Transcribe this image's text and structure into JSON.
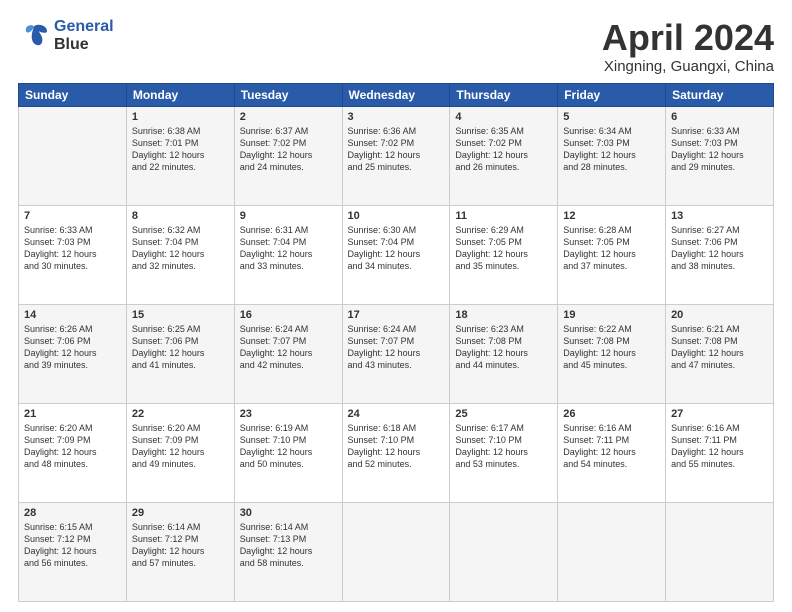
{
  "header": {
    "logo_line1": "General",
    "logo_line2": "Blue",
    "title": "April 2024",
    "location": "Xingning, Guangxi, China"
  },
  "columns": [
    "Sunday",
    "Monday",
    "Tuesday",
    "Wednesday",
    "Thursday",
    "Friday",
    "Saturday"
  ],
  "weeks": [
    [
      {
        "day": "",
        "info": ""
      },
      {
        "day": "1",
        "info": "Sunrise: 6:38 AM\nSunset: 7:01 PM\nDaylight: 12 hours\nand 22 minutes."
      },
      {
        "day": "2",
        "info": "Sunrise: 6:37 AM\nSunset: 7:02 PM\nDaylight: 12 hours\nand 24 minutes."
      },
      {
        "day": "3",
        "info": "Sunrise: 6:36 AM\nSunset: 7:02 PM\nDaylight: 12 hours\nand 25 minutes."
      },
      {
        "day": "4",
        "info": "Sunrise: 6:35 AM\nSunset: 7:02 PM\nDaylight: 12 hours\nand 26 minutes."
      },
      {
        "day": "5",
        "info": "Sunrise: 6:34 AM\nSunset: 7:03 PM\nDaylight: 12 hours\nand 28 minutes."
      },
      {
        "day": "6",
        "info": "Sunrise: 6:33 AM\nSunset: 7:03 PM\nDaylight: 12 hours\nand 29 minutes."
      }
    ],
    [
      {
        "day": "7",
        "info": "Sunrise: 6:33 AM\nSunset: 7:03 PM\nDaylight: 12 hours\nand 30 minutes."
      },
      {
        "day": "8",
        "info": "Sunrise: 6:32 AM\nSunset: 7:04 PM\nDaylight: 12 hours\nand 32 minutes."
      },
      {
        "day": "9",
        "info": "Sunrise: 6:31 AM\nSunset: 7:04 PM\nDaylight: 12 hours\nand 33 minutes."
      },
      {
        "day": "10",
        "info": "Sunrise: 6:30 AM\nSunset: 7:04 PM\nDaylight: 12 hours\nand 34 minutes."
      },
      {
        "day": "11",
        "info": "Sunrise: 6:29 AM\nSunset: 7:05 PM\nDaylight: 12 hours\nand 35 minutes."
      },
      {
        "day": "12",
        "info": "Sunrise: 6:28 AM\nSunset: 7:05 PM\nDaylight: 12 hours\nand 37 minutes."
      },
      {
        "day": "13",
        "info": "Sunrise: 6:27 AM\nSunset: 7:06 PM\nDaylight: 12 hours\nand 38 minutes."
      }
    ],
    [
      {
        "day": "14",
        "info": "Sunrise: 6:26 AM\nSunset: 7:06 PM\nDaylight: 12 hours\nand 39 minutes."
      },
      {
        "day": "15",
        "info": "Sunrise: 6:25 AM\nSunset: 7:06 PM\nDaylight: 12 hours\nand 41 minutes."
      },
      {
        "day": "16",
        "info": "Sunrise: 6:24 AM\nSunset: 7:07 PM\nDaylight: 12 hours\nand 42 minutes."
      },
      {
        "day": "17",
        "info": "Sunrise: 6:24 AM\nSunset: 7:07 PM\nDaylight: 12 hours\nand 43 minutes."
      },
      {
        "day": "18",
        "info": "Sunrise: 6:23 AM\nSunset: 7:08 PM\nDaylight: 12 hours\nand 44 minutes."
      },
      {
        "day": "19",
        "info": "Sunrise: 6:22 AM\nSunset: 7:08 PM\nDaylight: 12 hours\nand 45 minutes."
      },
      {
        "day": "20",
        "info": "Sunrise: 6:21 AM\nSunset: 7:08 PM\nDaylight: 12 hours\nand 47 minutes."
      }
    ],
    [
      {
        "day": "21",
        "info": "Sunrise: 6:20 AM\nSunset: 7:09 PM\nDaylight: 12 hours\nand 48 minutes."
      },
      {
        "day": "22",
        "info": "Sunrise: 6:20 AM\nSunset: 7:09 PM\nDaylight: 12 hours\nand 49 minutes."
      },
      {
        "day": "23",
        "info": "Sunrise: 6:19 AM\nSunset: 7:10 PM\nDaylight: 12 hours\nand 50 minutes."
      },
      {
        "day": "24",
        "info": "Sunrise: 6:18 AM\nSunset: 7:10 PM\nDaylight: 12 hours\nand 52 minutes."
      },
      {
        "day": "25",
        "info": "Sunrise: 6:17 AM\nSunset: 7:10 PM\nDaylight: 12 hours\nand 53 minutes."
      },
      {
        "day": "26",
        "info": "Sunrise: 6:16 AM\nSunset: 7:11 PM\nDaylight: 12 hours\nand 54 minutes."
      },
      {
        "day": "27",
        "info": "Sunrise: 6:16 AM\nSunset: 7:11 PM\nDaylight: 12 hours\nand 55 minutes."
      }
    ],
    [
      {
        "day": "28",
        "info": "Sunrise: 6:15 AM\nSunset: 7:12 PM\nDaylight: 12 hours\nand 56 minutes."
      },
      {
        "day": "29",
        "info": "Sunrise: 6:14 AM\nSunset: 7:12 PM\nDaylight: 12 hours\nand 57 minutes."
      },
      {
        "day": "30",
        "info": "Sunrise: 6:14 AM\nSunset: 7:13 PM\nDaylight: 12 hours\nand 58 minutes."
      },
      {
        "day": "",
        "info": ""
      },
      {
        "day": "",
        "info": ""
      },
      {
        "day": "",
        "info": ""
      },
      {
        "day": "",
        "info": ""
      }
    ]
  ]
}
